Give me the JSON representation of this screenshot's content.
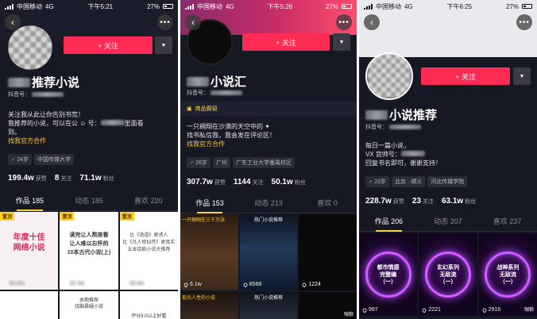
{
  "colors": {
    "accent": "#fe2c55",
    "tab_indicator": "#ffd23f",
    "background": "#161823"
  },
  "panels": [
    {
      "status": {
        "carrier": "中国移动",
        "network": "4G",
        "time": "下午5:21",
        "battery": "27%"
      },
      "follow_label": "+ 关注",
      "name": "推荐小说",
      "id_label": "抖音号：",
      "bio": [
        "关注我从此让你告别书荒！",
        "我推荐的小说，可以在公",
        "到。"
      ],
      "bio_suffix": "里面看",
      "bio_mid": "号：",
      "bio_link": "找我官方合作",
      "tags": [
        "24岁",
        "中国传媒大学"
      ],
      "stats": [
        {
          "value": "199.4w",
          "label": "获赞"
        },
        {
          "value": "8",
          "label": "关注"
        },
        {
          "value": "71.1w",
          "label": "粉丝"
        }
      ],
      "tabs": [
        "作品 185",
        "动态 185",
        "喜欢 220"
      ],
      "pin_label": "置顶",
      "cells": [
        {
          "text": "年度十佳\n网络小说",
          "likes": "54.0w"
        },
        {
          "text": "读完让人熬夜看\n让人难以忘怀的\n10本古代小说(上)",
          "likes": "22.4w"
        },
        {
          "text": "比《诡道》更诱人\n比《凡人修仙传》更真实\n五本烧疯小说大推荐",
          "likes": "19.6w"
        },
        {
          "text": "",
          "likes": ""
        },
        {
          "text": "本期推荐\n烧脑悬疑小说",
          "likes": ""
        },
        {
          "text": "评分9.0以上好看",
          "likes": ""
        }
      ]
    },
    {
      "status": {
        "carrier": "中国移动",
        "network": "4G",
        "time": "下午5:26",
        "battery": "27%"
      },
      "follow_label": "+ 关注",
      "name": "小说汇",
      "id_label": "抖音号：",
      "shop_label": "商品橱窗",
      "bio": [
        "一只翱翔在沙漠的天空中的",
        "找书私信我，我会发在评论区！"
      ],
      "bio_link": "找我官方合作",
      "tags": [
        "26岁",
        "广州",
        "广东工业大学番禺校区"
      ],
      "stats": [
        {
          "value": "307.7w",
          "label": "获赞"
        },
        {
          "value": "1144",
          "label": "关注"
        },
        {
          "value": "50.1w",
          "label": "粉丝"
        }
      ],
      "tabs": [
        "作品 153",
        "动态 213",
        "喜欢 0"
      ],
      "cells": [
        {
          "text": "一只翱翔在三千万张",
          "likes": "6.1w"
        },
        {
          "text": "热门小说推荐",
          "likes": "8568"
        },
        {
          "text": "",
          "likes": "1224"
        },
        {
          "text": "现光人性的小说",
          "likes": ""
        },
        {
          "text": "热门小说推荐",
          "likes": ""
        },
        {
          "text": "",
          "likes": ""
        }
      ],
      "watermark": "咖狼"
    },
    {
      "status": {
        "carrier": "中国移动",
        "network": "4G",
        "time": "下午6:25",
        "battery": "27%"
      },
      "follow_label": "+ 关注",
      "name": "小说推荐",
      "id_label": "抖音号：",
      "bio": [
        "每日一篇小说，",
        "VX 宫帅号：",
        "回复书名即可，谢谢支持！"
      ],
      "tags": [
        "23岁",
        "北京 · 顺义",
        "河北传媒学院"
      ],
      "stats": [
        {
          "value": "228.7w",
          "label": "获赞"
        },
        {
          "value": "23",
          "label": "关注"
        },
        {
          "value": "63.1w",
          "label": "粉丝"
        }
      ],
      "tabs": [
        "作品 206",
        "动态 207",
        "喜欢 237"
      ],
      "cells": [
        {
          "text": "都市情感\n完整编\n（一）",
          "likes": "997"
        },
        {
          "text": "玄幻系列\n无敌流\n（一）",
          "likes": "2221"
        },
        {
          "text": "战神系列\n无敌流\n（一）",
          "likes": "2916"
        }
      ],
      "watermark": "咖狼"
    }
  ]
}
